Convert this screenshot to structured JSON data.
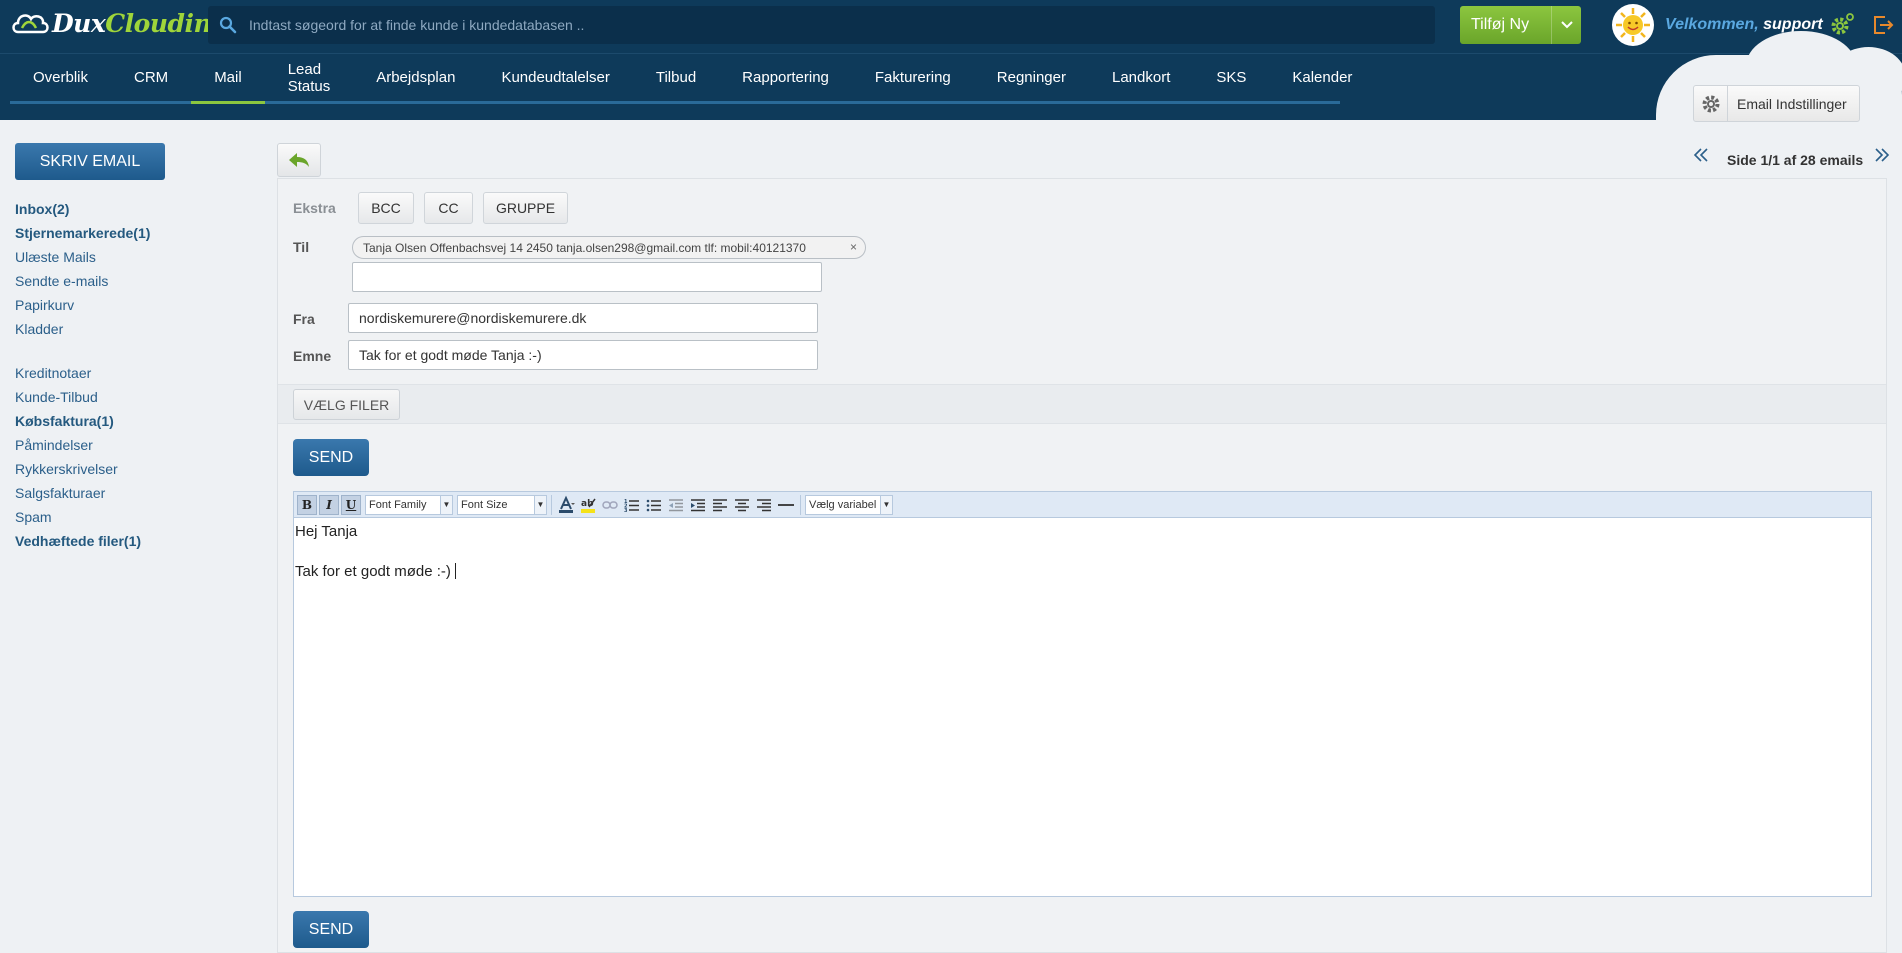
{
  "app": {
    "logo_text_1": "Dux",
    "logo_text_2": "Clouding",
    "search_placeholder": "Indtast søgeord for at finde kunde i kundedatabasen ..",
    "add_new_label": "Tilføj Ny",
    "welcome_prefix": "Velkommen,",
    "welcome_user": "support",
    "accent_color": "#8cc63f",
    "brand_color": "#0e3a5a"
  },
  "nav": {
    "items": [
      "Overblik",
      "CRM",
      "Mail",
      "Lead Status",
      "Arbejdsplan",
      "Kundeudtalelser",
      "Tilbud",
      "Rapportering",
      "Fakturering",
      "Regninger",
      "Landkort",
      "SKS",
      "Kalender"
    ],
    "active": "Mail",
    "email_settings_label": "Email Indstillinger"
  },
  "sidebar": {
    "compose_label": "SKRIV EMAIL",
    "folders": [
      {
        "label": "Inbox(2)",
        "bold": true
      },
      {
        "label": "Stjernemarkerede(1)",
        "bold": true
      },
      {
        "label": "Ulæste Mails",
        "bold": false
      },
      {
        "label": "Sendte e-mails",
        "bold": false
      },
      {
        "label": "Papirkurv",
        "bold": false
      },
      {
        "label": "Kladder",
        "bold": false
      }
    ],
    "documents": [
      {
        "label": "Kreditnotaer",
        "bold": false
      },
      {
        "label": "Kunde-Tilbud",
        "bold": false
      },
      {
        "label": "Købsfaktura(1)",
        "bold": true
      },
      {
        "label": "Påmindelser",
        "bold": false
      },
      {
        "label": "Rykkerskrivelser",
        "bold": false
      },
      {
        "label": "Salgsfakturaer",
        "bold": false
      },
      {
        "label": "Spam",
        "bold": false
      },
      {
        "label": "Vedhæftede filer(1)",
        "bold": true
      }
    ]
  },
  "pager": {
    "text": "Side 1/1 af 28 emails"
  },
  "compose": {
    "extra_label": "Ekstra",
    "bcc_label": "BCC",
    "cc_label": "CC",
    "group_label": "GRUPPE",
    "to_label": "Til",
    "recipient": "Tanja Olsen Offenbachsvej 14 2450 tanja.olsen298@gmail.com tlf: mobil:40121370",
    "recipient_remove": "×",
    "to_input_value": "",
    "from_label": "Fra",
    "from_value": "nordiskemurere@nordiskemurere.dk",
    "subject_label": "Emne",
    "subject_value": "Tak for et godt møde Tanja :-)",
    "choose_files_label": "VÆLG FILER",
    "send_label": "SEND"
  },
  "editor": {
    "font_family_label": "Font Family",
    "font_size_label": "Font Size",
    "variable_label": "Vælg variabel",
    "body_line_1": "Hej Tanja",
    "body_line_2": "Tak for et godt møde :-)"
  }
}
